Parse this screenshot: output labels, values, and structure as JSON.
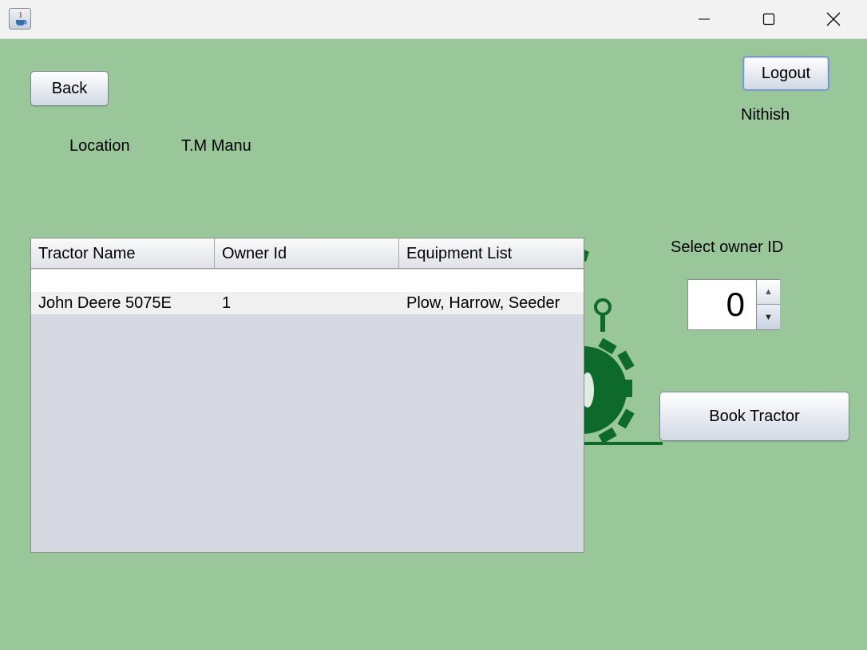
{
  "window": {
    "app_icon": "java-coffee-icon",
    "controls": [
      "minimize-icon",
      "maximize-icon",
      "close-icon"
    ]
  },
  "buttons": {
    "back": "Back",
    "logout": "Logout",
    "book": "Book Tractor"
  },
  "user": {
    "name": "Nithish"
  },
  "location": {
    "label": "Location",
    "value": "T.M Manu"
  },
  "table": {
    "columns": [
      "Tractor Name",
      "Owner Id",
      "Equipment List"
    ],
    "rows": [
      [
        "John Deere 5075E",
        "1",
        "Plow, Harrow, Seeder"
      ]
    ]
  },
  "owner_select": {
    "label": "Select owner ID",
    "value": "0"
  },
  "colors": {
    "background": "#9ac79a",
    "logo_green": "#0e6a2a",
    "table_bg": "#d6d9e1"
  }
}
